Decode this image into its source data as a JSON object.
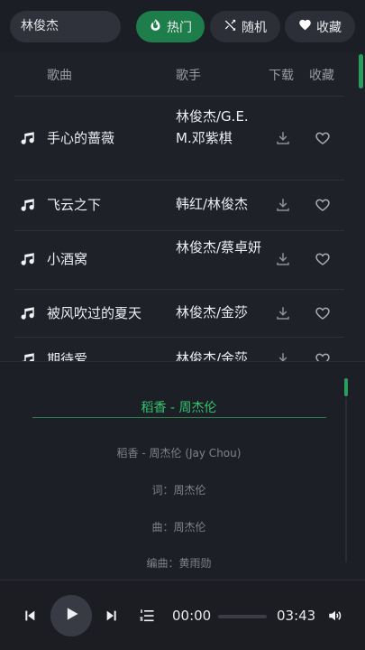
{
  "search": {
    "value": "林俊杰"
  },
  "tabs": [
    {
      "label": "热门",
      "icon": "fire-icon",
      "active": true
    },
    {
      "label": "随机",
      "icon": "shuffle-icon",
      "active": false
    },
    {
      "label": "收藏",
      "icon": "heart-icon",
      "active": false
    }
  ],
  "table": {
    "headers": {
      "song": "歌曲",
      "artist": "歌手",
      "download": "下载",
      "favorite": "收藏"
    },
    "rows": [
      {
        "title": "手心的蔷薇",
        "artist": "林俊杰/G.E.M.邓紫棋"
      },
      {
        "title": "飞云之下",
        "artist": "韩红/林俊杰"
      },
      {
        "title": "小酒窝",
        "artist": "林俊杰/蔡卓妍"
      },
      {
        "title": "被风吹过的夏天",
        "artist": "林俊杰/金莎"
      },
      {
        "title": "期待爱",
        "artist": "林俊杰/金莎"
      }
    ]
  },
  "lyrics": {
    "title": "稻香 - 周杰伦",
    "lines": [
      "稻香 - 周杰伦 (Jay Chou)",
      "词：周杰伦",
      "曲：周杰伦",
      "编曲：黄雨勋"
    ]
  },
  "player": {
    "current_time": "00:00",
    "duration": "03:43",
    "progress": 0
  },
  "colors": {
    "accent": "#2fc46e",
    "active_tab": "#1e7e4b",
    "background": "#1f2129"
  }
}
